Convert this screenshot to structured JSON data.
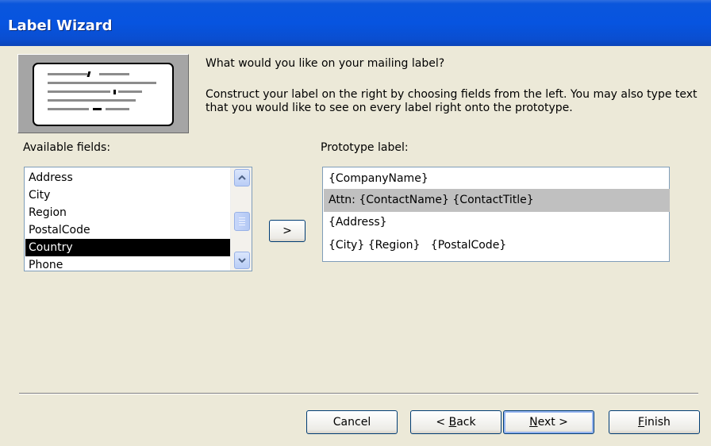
{
  "window": {
    "title": "Label Wizard"
  },
  "prompt": "What would you like on your mailing label?",
  "instructions": "Construct your label on the right by choosing fields from the left. You may also type text that you would like to see on every label right onto the prototype.",
  "available_fields": {
    "label": "Available fields:",
    "items": [
      "Address",
      "City",
      "Region",
      "PostalCode",
      "Country",
      "Phone"
    ],
    "selected": "Country"
  },
  "add_button": {
    "label": ">"
  },
  "prototype": {
    "label": "Prototype label:",
    "lines": [
      "{CompanyName}",
      "Attn: {ContactName} {ContactTitle}",
      "{Address}",
      "{City} {Region}   {PostalCode}"
    ],
    "highlighted_line": 1
  },
  "buttons": {
    "cancel": "Cancel",
    "back_prefix": "< ",
    "back_accel": "B",
    "back_rest": "ack",
    "next_accel": "N",
    "next_rest": "ext >",
    "finish_accel": "F",
    "finish_rest": "inish"
  },
  "colors": {
    "titlebar": "#0754e0",
    "face": "#ece9d8",
    "selection": "#000000",
    "highlight": "#c0c0c0"
  }
}
